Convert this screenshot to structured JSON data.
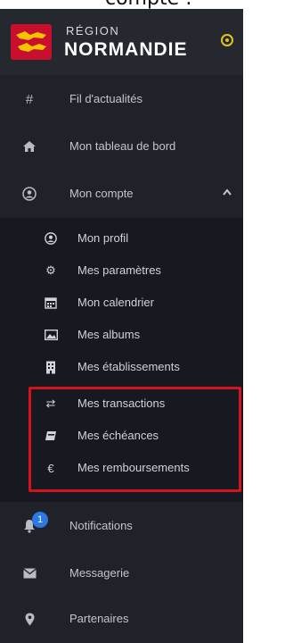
{
  "caption": {
    "text": "compte :"
  },
  "brand": {
    "top": "RÉGION",
    "main": "NORMANDIE"
  },
  "menu": {
    "fil": "Fil d'actualités",
    "tableau": "Mon tableau de bord",
    "compte": "Mon compte"
  },
  "submenu": {
    "profil": "Mon profil",
    "parametres": "Mes paramètres",
    "calendrier": "Mon calendrier",
    "albums": "Mes albums",
    "etablissements": "Mes établissements",
    "transactions": "Mes transactions",
    "echeances": "Mes échéances",
    "remboursements": "Mes remboursements"
  },
  "bottom": {
    "notifications": "Notifications",
    "notifications_badge": "1",
    "messagerie": "Messagerie",
    "partenaires": "Partenaires"
  },
  "colors": {
    "sidebar_bg": "#1f2229",
    "submenu_bg": "#161920",
    "highlight": "#d4141c",
    "status": "#e2c21b",
    "badge": "#2b78e4"
  }
}
